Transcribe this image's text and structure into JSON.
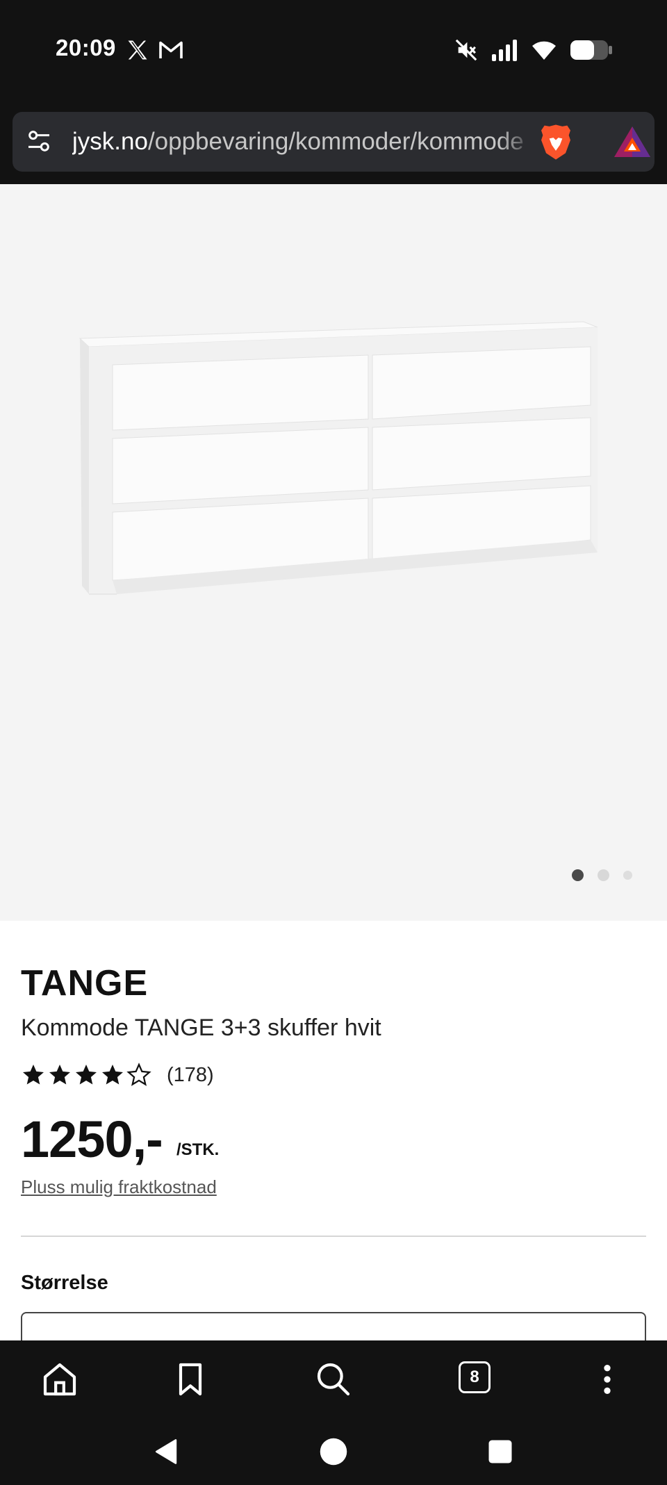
{
  "status_bar": {
    "time": "20:09",
    "icons": [
      "x-app-icon",
      "gmail-icon",
      "mute-icon",
      "signal-icon",
      "wifi-icon",
      "battery-icon"
    ]
  },
  "browser": {
    "url_domain": "jysk.no",
    "url_path": "/oppbevaring/kommoder/kommode",
    "tab_count": "8"
  },
  "product": {
    "brand": "TANGE",
    "name": "Kommode TANGE 3+3 skuffer hvit",
    "rating_stars": 4,
    "rating_max": 5,
    "rating_count": "(178)",
    "price": "1250,-",
    "price_unit": "/STK.",
    "shipping_note": "Pluss mulig fraktkostnad",
    "size_label": "Størrelse",
    "image_count": 3,
    "image_active_index": 0
  },
  "colors": {
    "background_dark": "#121212",
    "url_bar": "#2b2c30",
    "hero_bg": "#f4f4f4",
    "text": "#111111",
    "brave_orange": "#fb542b"
  }
}
